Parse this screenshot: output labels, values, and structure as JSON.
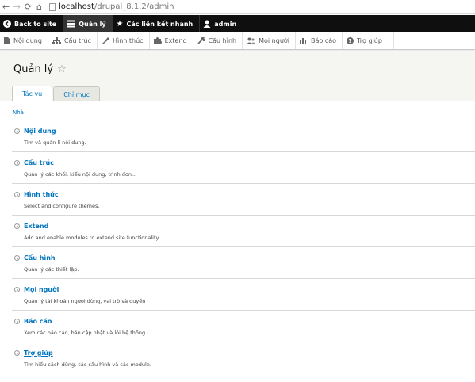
{
  "browser": {
    "url_host": "localhost",
    "url_path": "/drupal_8.1.2/admin"
  },
  "toolbar": {
    "back_to_site": "Back to site",
    "manage": "Quản lý",
    "shortcuts": "Các liên kết nhanh",
    "user": "admin"
  },
  "tray": {
    "items": [
      {
        "label": "Nội dung",
        "icon": "file-icon"
      },
      {
        "label": "Cấu trúc",
        "icon": "sitemap-icon"
      },
      {
        "label": "Hình thức",
        "icon": "paintbrush-icon"
      },
      {
        "label": "Extend",
        "icon": "puzzle-icon"
      },
      {
        "label": "Cấu hình",
        "icon": "wrench-icon"
      },
      {
        "label": "Mọi người",
        "icon": "people-icon"
      },
      {
        "label": "Báo cáo",
        "icon": "bar-chart-icon"
      },
      {
        "label": "Trợ giúp",
        "icon": "help-icon"
      }
    ]
  },
  "header": {
    "title": "Quản lý",
    "tabs": [
      {
        "label": "Tác vụ",
        "active": true
      },
      {
        "label": "Chỉ mục",
        "active": false
      }
    ]
  },
  "breadcrumb": "Nhà",
  "admin_list": [
    {
      "title": "Nội dung",
      "desc": "Tìm và quản lí nội dung."
    },
    {
      "title": "Cấu trúc",
      "desc": "Quản lý các khối, kiểu nội dung, trình đơn..."
    },
    {
      "title": "Hình thức",
      "desc": "Select and configure themes."
    },
    {
      "title": "Extend",
      "desc": "Add and enable modules to extend site functionality."
    },
    {
      "title": "Cấu hình",
      "desc": "Quản lý các thiết lập."
    },
    {
      "title": "Mọi người",
      "desc": "Quản lý tài khoản người dùng, vai trò và quyền"
    },
    {
      "title": "Báo cáo",
      "desc": "Xem các báo cáo, bản cập nhật và lỗi hệ thống."
    },
    {
      "title": "Trợ giúp",
      "desc": "Tìm hiểu cách dùng, các cấu hình và các module."
    }
  ],
  "colors": {
    "link": "#0074bd",
    "toolbar_bg": "#0f0f0f",
    "header_bg": "#f5f5f2"
  }
}
